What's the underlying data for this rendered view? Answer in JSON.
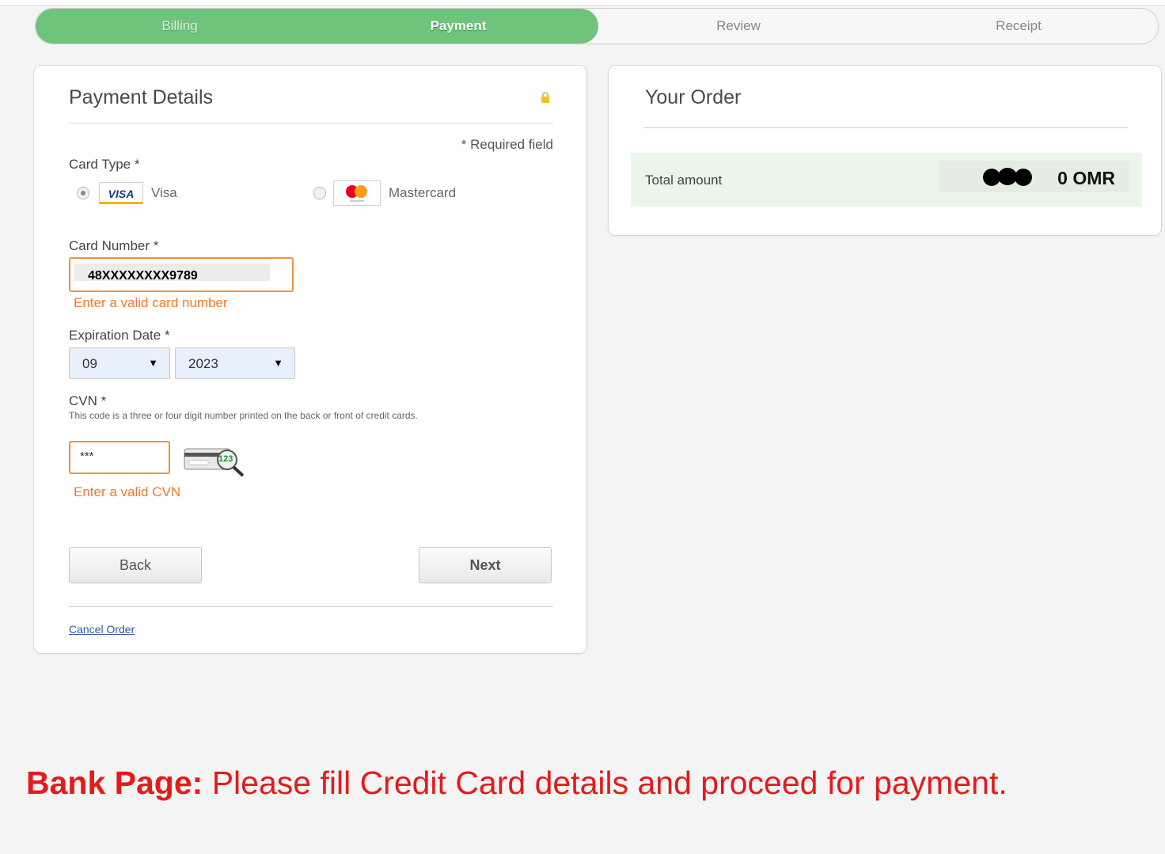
{
  "steps": {
    "billing": "Billing",
    "payment": "Payment",
    "review": "Review",
    "receipt": "Receipt"
  },
  "payment_details": {
    "title": "Payment Details",
    "required_note": "* Required field",
    "card_type_label": "Card Type *",
    "card_types": [
      {
        "label": "Visa",
        "logo_text": "VISA",
        "selected": true
      },
      {
        "label": "Mastercard",
        "selected": false
      }
    ],
    "card_number_label": "Card Number *",
    "card_number_value": "48XXXXXXXX9789",
    "card_number_error": "Enter a valid card number",
    "expiration_label": "Expiration Date *",
    "exp_month": "09",
    "exp_year": "2023",
    "cvn_label": "CVN *",
    "cvn_help": "This code is a three or four digit number printed on the back or front of credit cards.",
    "cvn_value": "***",
    "cvn_icon_text": "123",
    "cvn_error": "Enter a valid CVN",
    "back_label": "Back",
    "next_label": "Next",
    "cancel_label": "Cancel Order"
  },
  "order": {
    "title": "Your Order",
    "total_label": "Total amount",
    "total_value": "0 OMR"
  },
  "caption": {
    "bold": "Bank Page:",
    "text": " Please fill Credit Card details and proceed for payment."
  },
  "colors": {
    "progress_green": "#6fc37a",
    "error_orange": "#ee7a2c",
    "caption_red": "#e31b1b"
  }
}
